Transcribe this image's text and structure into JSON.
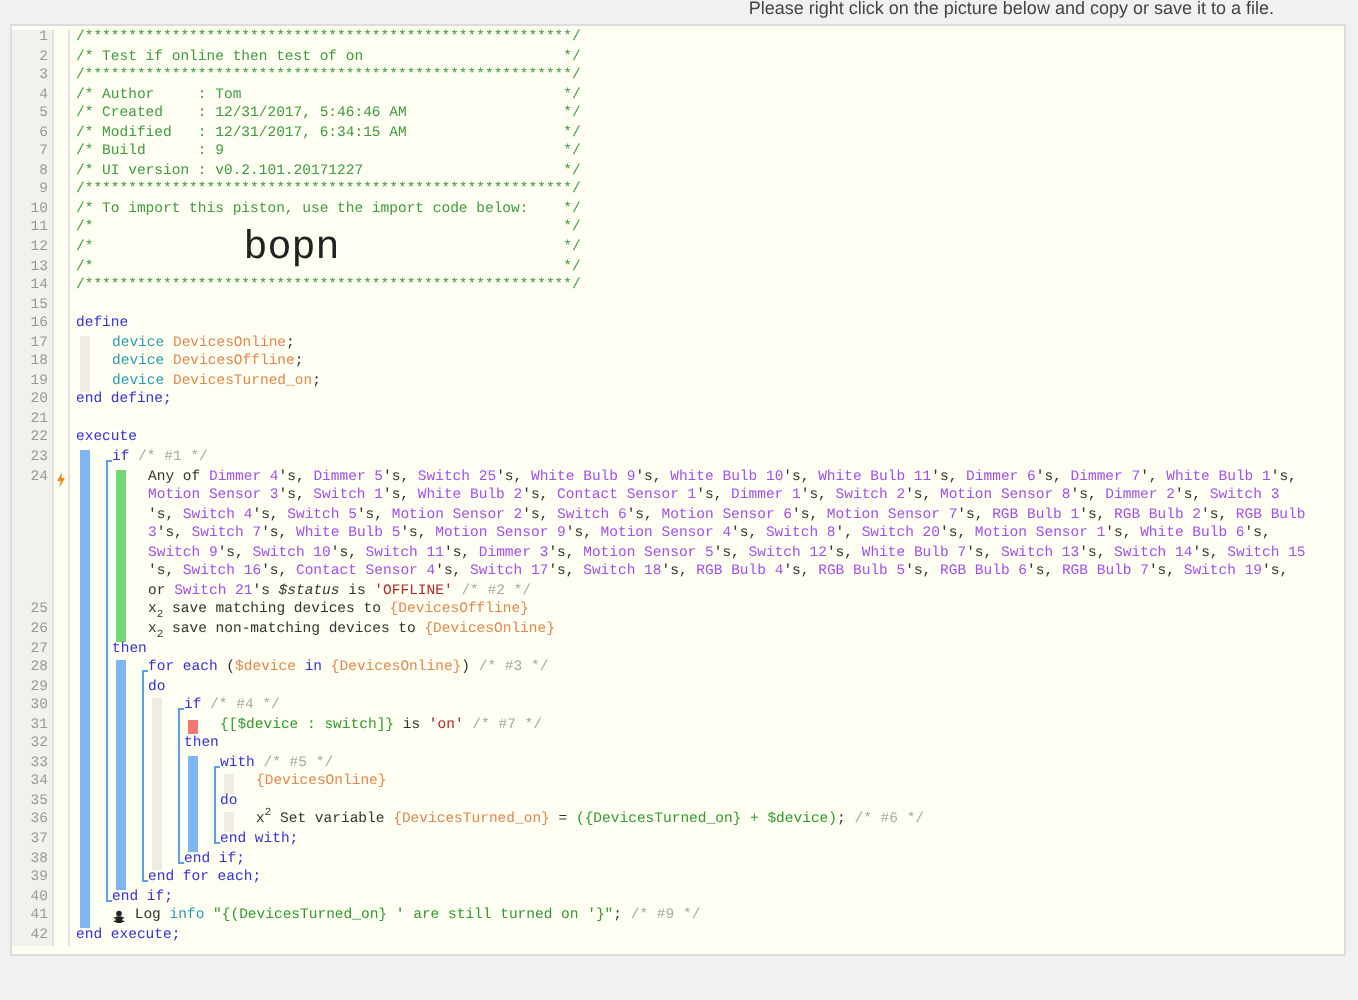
{
  "banner": "Please right click on the picture below and copy or save it to a file.",
  "lines": [
    {
      "number": "1",
      "trigger": false,
      "tokens": [
        {
          "kind": "comment",
          "text": "/********************************************************/"
        }
      ]
    },
    {
      "number": "2",
      "trigger": false,
      "tokens": [
        {
          "kind": "comment-start",
          "text": "/* Test if online then test of on"
        },
        {
          "kind": "comment",
          "text": "*/"
        }
      ]
    },
    {
      "number": "3",
      "trigger": false,
      "tokens": [
        {
          "kind": "comment",
          "text": "/********************************************************/"
        }
      ]
    },
    {
      "number": "4",
      "trigger": false,
      "tokens": [
        {
          "kind": "comment-start",
          "text": "/* Author     : Tom"
        },
        {
          "kind": "comment",
          "text": "*/"
        }
      ]
    },
    {
      "number": "5",
      "trigger": false,
      "tokens": [
        {
          "kind": "comment-start",
          "text": "/* Created    : 12/31/2017, 5:46:46 AM"
        },
        {
          "kind": "comment",
          "text": "*/"
        }
      ]
    },
    {
      "number": "6",
      "trigger": false,
      "tokens": [
        {
          "kind": "comment-start",
          "text": "/* Modified   : 12/31/2017, 6:34:15 AM"
        },
        {
          "kind": "comment",
          "text": "*/"
        }
      ]
    },
    {
      "number": "7",
      "trigger": false,
      "tokens": [
        {
          "kind": "comment-start",
          "text": "/* Build      : 9"
        },
        {
          "kind": "comment",
          "text": "*/"
        }
      ]
    },
    {
      "number": "8",
      "trigger": false,
      "tokens": [
        {
          "kind": "comment-start",
          "text": "/* UI version : v0.2.101.20171227"
        },
        {
          "kind": "comment",
          "text": "*/"
        }
      ]
    },
    {
      "number": "9",
      "trigger": false,
      "tokens": [
        {
          "kind": "comment",
          "text": "/********************************************************/"
        }
      ]
    },
    {
      "number": "10",
      "trigger": false,
      "tokens": [
        {
          "kind": "comment-start",
          "text": "/* To import this piston, use the import code below:"
        },
        {
          "kind": "comment",
          "text": "*/"
        }
      ]
    },
    {
      "number": "11",
      "trigger": false,
      "tokens": [
        {
          "kind": "comment-start",
          "text": "/*"
        },
        {
          "kind": "comment",
          "text": "*/"
        }
      ]
    },
    {
      "number": "12",
      "trigger": false,
      "tokens": [
        {
          "kind": "comment-start",
          "text": "/*"
        },
        {
          "kind": "import-code",
          "text": "bopn"
        },
        {
          "kind": "comment",
          "text": "*/"
        }
      ]
    },
    {
      "number": "13",
      "trigger": false,
      "tokens": [
        {
          "kind": "comment-start",
          "text": "/*"
        },
        {
          "kind": "comment",
          "text": "*/"
        }
      ]
    },
    {
      "number": "14",
      "trigger": false,
      "tokens": [
        {
          "kind": "comment",
          "text": "/********************************************************/"
        }
      ]
    },
    {
      "number": "15",
      "trigger": false
    },
    {
      "number": "16",
      "trigger": false,
      "tokens": [
        {
          "kind": "keyword",
          "text": "define"
        }
      ]
    },
    {
      "number": "17",
      "trigger": false,
      "gutter": [
        {
          "kind": "pad"
        },
        {
          "kind": "blank"
        }
      ],
      "tokens": [
        {
          "kind": "type",
          "text": "device "
        },
        {
          "kind": "variable",
          "text": "DevicesOnline"
        },
        {
          "kind": "text",
          "text": ";"
        }
      ]
    },
    {
      "number": "18",
      "trigger": false,
      "gutter": [
        {
          "kind": "pad"
        },
        {
          "kind": "blank"
        }
      ],
      "tokens": [
        {
          "kind": "type",
          "text": "device "
        },
        {
          "kind": "variable",
          "text": "DevicesOffline"
        },
        {
          "kind": "text",
          "text": ";"
        }
      ]
    },
    {
      "number": "19",
      "trigger": false,
      "gutter": [
        {
          "kind": "pad"
        },
        {
          "kind": "blank"
        }
      ],
      "tokens": [
        {
          "kind": "type",
          "text": "device "
        },
        {
          "kind": "variable",
          "text": "DevicesTurned_on"
        },
        {
          "kind": "text",
          "text": ";"
        }
      ]
    },
    {
      "number": "20",
      "trigger": false,
      "tokens": [
        {
          "kind": "keyword",
          "text": "end define;"
        }
      ]
    },
    {
      "number": "21",
      "trigger": false
    },
    {
      "number": "22",
      "trigger": false,
      "tokens": [
        {
          "kind": "keyword",
          "text": "execute"
        }
      ]
    },
    {
      "number": "23",
      "trigger": false,
      "gutter": [
        {
          "kind": "bar"
        },
        {
          "kind": "open"
        }
      ],
      "tokens": [
        {
          "kind": "keyword",
          "text": "if"
        },
        {
          "kind": "note",
          "text": " /* #1 */"
        }
      ]
    },
    {
      "number": "24",
      "trigger": true,
      "gutter": [
        {
          "kind": "bar"
        },
        {
          "kind": "line"
        },
        {
          "kind": "cond"
        },
        {
          "kind": "blank"
        }
      ],
      "rows": [
        {
          "tokens": [
            {
              "kind": "text",
              "text": "Any of "
            },
            {
              "kind": "device",
              "text": "Dimmer 4"
            },
            {
              "kind": "text",
              "text": "'s, "
            },
            {
              "kind": "device",
              "text": "Dimmer 5"
            },
            {
              "kind": "text",
              "text": "'s, "
            },
            {
              "kind": "device",
              "text": "Switch 25"
            },
            {
              "kind": "text",
              "text": "'s, "
            },
            {
              "kind": "device",
              "text": "White Bulb 9"
            },
            {
              "kind": "text",
              "text": "'s, "
            },
            {
              "kind": "device",
              "text": "White Bulb 10"
            },
            {
              "kind": "text",
              "text": "'s, "
            },
            {
              "kind": "device",
              "text": "White Bulb 11"
            },
            {
              "kind": "text",
              "text": "'s, "
            },
            {
              "kind": "device",
              "text": "Dimmer 6"
            },
            {
              "kind": "text",
              "text": "'s, "
            },
            {
              "kind": "device",
              "text": "Dimmer 7"
            },
            {
              "kind": "text",
              "text": "', "
            },
            {
              "kind": "device",
              "text": "White Bulb 1"
            },
            {
              "kind": "text",
              "text": "'s,"
            }
          ]
        },
        {
          "tokens": [
            {
              "kind": "device",
              "text": "Motion Sensor 3"
            },
            {
              "kind": "text",
              "text": "'s, "
            },
            {
              "kind": "device",
              "text": "Switch 1"
            },
            {
              "kind": "text",
              "text": "'s, "
            },
            {
              "kind": "device",
              "text": "White Bulb 2"
            },
            {
              "kind": "text",
              "text": "'s, "
            },
            {
              "kind": "device",
              "text": "Contact Sensor 1"
            },
            {
              "kind": "text",
              "text": "'s, "
            },
            {
              "kind": "device",
              "text": "Dimmer 1"
            },
            {
              "kind": "text",
              "text": "'s, "
            },
            {
              "kind": "device",
              "text": "Switch 2"
            },
            {
              "kind": "text",
              "text": "'s, "
            },
            {
              "kind": "device",
              "text": "Motion Sensor 8"
            },
            {
              "kind": "text",
              "text": "'s, "
            },
            {
              "kind": "device",
              "text": "Dimmer 2"
            },
            {
              "kind": "text",
              "text": "'s, "
            },
            {
              "kind": "device",
              "text": "Switch 3"
            }
          ]
        },
        {
          "tokens": [
            {
              "kind": "text",
              "text": "'s, "
            },
            {
              "kind": "device",
              "text": "Switch 4"
            },
            {
              "kind": "text",
              "text": "'s, "
            },
            {
              "kind": "device",
              "text": "Switch 5"
            },
            {
              "kind": "text",
              "text": "'s, "
            },
            {
              "kind": "device",
              "text": "Motion Sensor 2"
            },
            {
              "kind": "text",
              "text": "'s, "
            },
            {
              "kind": "device",
              "text": "Switch 6"
            },
            {
              "kind": "text",
              "text": "'s, "
            },
            {
              "kind": "device",
              "text": "Motion Sensor 6"
            },
            {
              "kind": "text",
              "text": "'s, "
            },
            {
              "kind": "device",
              "text": "Motion Sensor 7"
            },
            {
              "kind": "text",
              "text": "'s, "
            },
            {
              "kind": "device",
              "text": "RGB Bulb 1"
            },
            {
              "kind": "text",
              "text": "'s, "
            },
            {
              "kind": "device",
              "text": "RGB Bulb 2"
            },
            {
              "kind": "text",
              "text": "'s, "
            },
            {
              "kind": "device",
              "text": "RGB Bulb"
            }
          ]
        },
        {
          "tokens": [
            {
              "kind": "device",
              "text": "3"
            },
            {
              "kind": "text",
              "text": "'s, "
            },
            {
              "kind": "device",
              "text": "Switch 7"
            },
            {
              "kind": "text",
              "text": "'s, "
            },
            {
              "kind": "device",
              "text": "White Bulb 5"
            },
            {
              "kind": "text",
              "text": "'s, "
            },
            {
              "kind": "device",
              "text": "Motion Sensor 9"
            },
            {
              "kind": "text",
              "text": "'s, "
            },
            {
              "kind": "device",
              "text": "Motion Sensor 4"
            },
            {
              "kind": "text",
              "text": "'s, "
            },
            {
              "kind": "device",
              "text": "Switch 8"
            },
            {
              "kind": "text",
              "text": "', "
            },
            {
              "kind": "device",
              "text": "Switch 20"
            },
            {
              "kind": "text",
              "text": "'s, "
            },
            {
              "kind": "device",
              "text": "Motion Sensor 1"
            },
            {
              "kind": "text",
              "text": "'s, "
            },
            {
              "kind": "device",
              "text": "White Bulb 6"
            },
            {
              "kind": "text",
              "text": "'s,"
            }
          ]
        },
        {
          "tokens": [
            {
              "kind": "device",
              "text": "Switch 9"
            },
            {
              "kind": "text",
              "text": "'s, "
            },
            {
              "kind": "device",
              "text": "Switch 10"
            },
            {
              "kind": "text",
              "text": "'s, "
            },
            {
              "kind": "device",
              "text": "Switch 11"
            },
            {
              "kind": "text",
              "text": "'s, "
            },
            {
              "kind": "device",
              "text": "Dimmer 3"
            },
            {
              "kind": "text",
              "text": "'s, "
            },
            {
              "kind": "device",
              "text": "Motion Sensor 5"
            },
            {
              "kind": "text",
              "text": "'s, "
            },
            {
              "kind": "device",
              "text": "Switch 12"
            },
            {
              "kind": "text",
              "text": "'s, "
            },
            {
              "kind": "device",
              "text": "White Bulb 7"
            },
            {
              "kind": "text",
              "text": "'s, "
            },
            {
              "kind": "device",
              "text": "Switch 13"
            },
            {
              "kind": "text",
              "text": "'s, "
            },
            {
              "kind": "device",
              "text": "Switch 14"
            },
            {
              "kind": "text",
              "text": "'s, "
            },
            {
              "kind": "device",
              "text": "Switch 15"
            }
          ]
        },
        {
          "tokens": [
            {
              "kind": "text",
              "text": "'s, "
            },
            {
              "kind": "device",
              "text": "Switch 16"
            },
            {
              "kind": "text",
              "text": "'s, "
            },
            {
              "kind": "device",
              "text": "Contact Sensor 4"
            },
            {
              "kind": "text",
              "text": "'s, "
            },
            {
              "kind": "device",
              "text": "Switch 17"
            },
            {
              "kind": "text",
              "text": "'s, "
            },
            {
              "kind": "device",
              "text": "Switch 18"
            },
            {
              "kind": "text",
              "text": "'s, "
            },
            {
              "kind": "device",
              "text": "RGB Bulb 4"
            },
            {
              "kind": "text",
              "text": "'s, "
            },
            {
              "kind": "device",
              "text": "RGB Bulb 5"
            },
            {
              "kind": "text",
              "text": "'s, "
            },
            {
              "kind": "device",
              "text": "RGB Bulb 6"
            },
            {
              "kind": "text",
              "text": "'s, "
            },
            {
              "kind": "device",
              "text": "RGB Bulb 7"
            },
            {
              "kind": "text",
              "text": "'s, "
            },
            {
              "kind": "device",
              "text": "Switch 19"
            },
            {
              "kind": "text",
              "text": "'s,"
            }
          ]
        },
        {
          "tokens": [
            {
              "kind": "text",
              "text": "or "
            },
            {
              "kind": "device",
              "text": "Switch 21"
            },
            {
              "kind": "text",
              "text": "'s "
            },
            {
              "kind": "attribute",
              "text": "$status"
            },
            {
              "kind": "text",
              "text": " is "
            },
            {
              "kind": "string",
              "text": "'OFFLINE'"
            },
            {
              "kind": "note",
              "text": " /* #2 */"
            }
          ]
        }
      ]
    },
    {
      "number": "25",
      "trigger": false,
      "gutter": [
        {
          "kind": "bar"
        },
        {
          "kind": "line"
        },
        {
          "kind": "cond"
        },
        {
          "kind": "blank"
        }
      ],
      "tokens": [
        {
          "kind": "text",
          "text": "x$_{2}$ save matching devices to "
        },
        {
          "kind": "variable",
          "text": "{DevicesOffline}"
        }
      ]
    },
    {
      "number": "26",
      "trigger": false,
      "gutter": [
        {
          "kind": "bar"
        },
        {
          "kind": "line"
        },
        {
          "kind": "cond"
        },
        {
          "kind": "blank"
        }
      ],
      "tokens": [
        {
          "kind": "text",
          "text": "x$_{2}$ save non-matching devices to "
        },
        {
          "kind": "variable",
          "text": "{DevicesOnline}"
        }
      ]
    },
    {
      "number": "27",
      "trigger": false,
      "gutter": [
        {
          "kind": "bar"
        },
        {
          "kind": "line"
        }
      ],
      "tokens": [
        {
          "kind": "keyword",
          "text": "then"
        }
      ]
    },
    {
      "number": "28",
      "trigger": false,
      "gutter": [
        {
          "kind": "bar"
        },
        {
          "kind": "line"
        },
        {
          "kind": "bar"
        },
        {
          "kind": "open"
        }
      ],
      "tokens": [
        {
          "kind": "keyword",
          "text": "for each"
        },
        {
          "kind": "text",
          "text": " ("
        },
        {
          "kind": "variable",
          "text": "$device"
        },
        {
          "kind": "keyword",
          "text": " in "
        },
        {
          "kind": "variable",
          "text": "{DevicesOnline}"
        },
        {
          "kind": "text",
          "text": ")"
        },
        {
          "kind": "note",
          "text": " /* #3 */"
        }
      ]
    },
    {
      "number": "29",
      "trigger": false,
      "gutter": [
        {
          "kind": "bar"
        },
        {
          "kind": "line"
        },
        {
          "kind": "bar"
        },
        {
          "kind": "line"
        }
      ],
      "tokens": [
        {
          "kind": "keyword",
          "text": "do"
        }
      ]
    },
    {
      "number": "30",
      "trigger": false,
      "gutter": [
        {
          "kind": "bar"
        },
        {
          "kind": "line"
        },
        {
          "kind": "bar"
        },
        {
          "kind": "line"
        },
        {
          "kind": "pad"
        },
        {
          "kind": "open"
        }
      ],
      "tokens": [
        {
          "kind": "keyword",
          "text": "if"
        },
        {
          "kind": "note",
          "text": " /* #4 */"
        }
      ]
    },
    {
      "number": "31",
      "trigger": false,
      "gutter": [
        {
          "kind": "bar"
        },
        {
          "kind": "line"
        },
        {
          "kind": "bar"
        },
        {
          "kind": "line"
        },
        {
          "kind": "pad"
        },
        {
          "kind": "line"
        },
        {
          "kind": "error"
        },
        {
          "kind": "blank"
        }
      ],
      "tokens": [
        {
          "kind": "expression",
          "text": "{[$device : switch]}"
        },
        {
          "kind": "text",
          "text": " is "
        },
        {
          "kind": "string",
          "text": "'on'"
        },
        {
          "kind": "note",
          "text": " /* #7 */"
        }
      ]
    },
    {
      "number": "32",
      "trigger": false,
      "gutter": [
        {
          "kind": "bar"
        },
        {
          "kind": "line"
        },
        {
          "kind": "bar"
        },
        {
          "kind": "line"
        },
        {
          "kind": "pad"
        },
        {
          "kind": "line"
        }
      ],
      "tokens": [
        {
          "kind": "keyword",
          "text": "then"
        }
      ]
    },
    {
      "number": "33",
      "trigger": false,
      "gutter": [
        {
          "kind": "bar"
        },
        {
          "kind": "line"
        },
        {
          "kind": "bar"
        },
        {
          "kind": "line"
        },
        {
          "kind": "pad"
        },
        {
          "kind": "line"
        },
        {
          "kind": "bar"
        },
        {
          "kind": "open"
        }
      ],
      "tokens": [
        {
          "kind": "keyword",
          "text": "with"
        },
        {
          "kind": "note",
          "text": " /* #5 */"
        }
      ]
    },
    {
      "number": "34",
      "trigger": false,
      "gutter": [
        {
          "kind": "bar"
        },
        {
          "kind": "line"
        },
        {
          "kind": "bar"
        },
        {
          "kind": "line"
        },
        {
          "kind": "pad"
        },
        {
          "kind": "line"
        },
        {
          "kind": "bar"
        },
        {
          "kind": "line"
        },
        {
          "kind": "pad"
        },
        {
          "kind": "blank"
        }
      ],
      "tokens": [
        {
          "kind": "variable",
          "text": "{DevicesOnline}"
        }
      ]
    },
    {
      "number": "35",
      "trigger": false,
      "gutter": [
        {
          "kind": "bar"
        },
        {
          "kind": "line"
        },
        {
          "kind": "bar"
        },
        {
          "kind": "line"
        },
        {
          "kind": "pad"
        },
        {
          "kind": "line"
        },
        {
          "kind": "bar"
        },
        {
          "kind": "line"
        }
      ],
      "tokens": [
        {
          "kind": "keyword",
          "text": "do"
        }
      ]
    },
    {
      "number": "36",
      "trigger": false,
      "gutter": [
        {
          "kind": "bar"
        },
        {
          "kind": "line"
        },
        {
          "kind": "bar"
        },
        {
          "kind": "line"
        },
        {
          "kind": "pad"
        },
        {
          "kind": "line"
        },
        {
          "kind": "bar"
        },
        {
          "kind": "line"
        },
        {
          "kind": "pad"
        },
        {
          "kind": "blank"
        }
      ],
      "tokens": [
        {
          "kind": "text",
          "text": "x$^{2}$ Set variable "
        },
        {
          "kind": "variable",
          "text": "{DevicesTurned_on}"
        },
        {
          "kind": "text",
          "text": " = "
        },
        {
          "kind": "expression",
          "text": "({DevicesTurned_on} + $device)"
        },
        {
          "kind": "text",
          "text": ";"
        },
        {
          "kind": "note",
          "text": " /* #6 */"
        }
      ]
    },
    {
      "number": "37",
      "trigger": false,
      "gutter": [
        {
          "kind": "bar"
        },
        {
          "kind": "line"
        },
        {
          "kind": "bar"
        },
        {
          "kind": "line"
        },
        {
          "kind": "pad"
        },
        {
          "kind": "line"
        },
        {
          "kind": "bar"
        },
        {
          "kind": "close"
        }
      ],
      "tokens": [
        {
          "kind": "keyword",
          "text": "end with;"
        }
      ]
    },
    {
      "number": "38",
      "trigger": false,
      "gutter": [
        {
          "kind": "bar"
        },
        {
          "kind": "line"
        },
        {
          "kind": "bar"
        },
        {
          "kind": "line"
        },
        {
          "kind": "pad"
        },
        {
          "kind": "close"
        }
      ],
      "tokens": [
        {
          "kind": "keyword",
          "text": "end if;"
        }
      ]
    },
    {
      "number": "39",
      "trigger": false,
      "gutter": [
        {
          "kind": "bar"
        },
        {
          "kind": "line"
        },
        {
          "kind": "bar"
        },
        {
          "kind": "close"
        }
      ],
      "tokens": [
        {
          "kind": "keyword",
          "text": "end for each;"
        }
      ]
    },
    {
      "number": "40",
      "trigger": false,
      "gutter": [
        {
          "kind": "bar"
        },
        {
          "kind": "close"
        }
      ],
      "tokens": [
        {
          "kind": "keyword",
          "text": "end if;"
        }
      ]
    },
    {
      "number": "41",
      "trigger": false,
      "gutter": [
        {
          "kind": "bar"
        },
        {
          "kind": "blank"
        }
      ],
      "tokens": [
        {
          "kind": "icon"
        },
        {
          "kind": "text",
          "text": " Log "
        },
        {
          "kind": "type",
          "text": "info"
        },
        {
          "kind": "expression",
          "text": " \"{(DevicesTurned_on} ' are still turned on '}\""
        },
        {
          "kind": "text",
          "text": ";"
        },
        {
          "kind": "note",
          "text": " /* #9 */"
        }
      ]
    },
    {
      "number": "42",
      "trigger": false,
      "tokens": [
        {
          "kind": "keyword",
          "text": "end execute;"
        }
      ]
    }
  ]
}
